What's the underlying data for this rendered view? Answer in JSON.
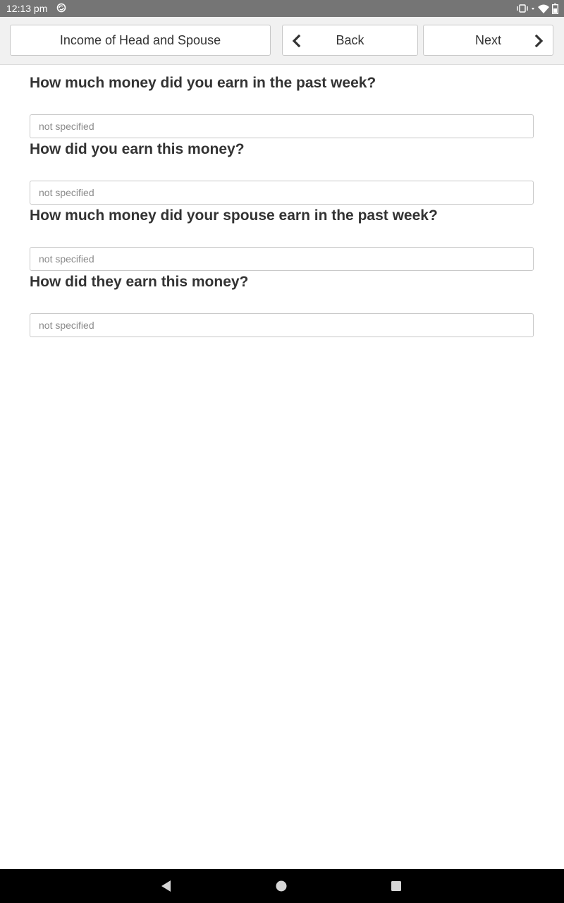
{
  "status_bar": {
    "time": "12:13 pm",
    "icons": [
      "sync-icon",
      "vibrate-icon",
      "wifi-icon",
      "battery-icon"
    ]
  },
  "toolbar": {
    "section_label": "Income of Head and Spouse",
    "back_label": "Back",
    "next_label": "Next"
  },
  "questions": [
    {
      "label": "How much money did you earn in the past week?",
      "value": "",
      "placeholder": "not specified"
    },
    {
      "label": "How did you earn this money?",
      "value": "",
      "placeholder": "not specified"
    },
    {
      "label": "How much money did your spouse earn in the past week?",
      "value": "",
      "placeholder": "not specified"
    },
    {
      "label": "How did they earn this money?",
      "value": "",
      "placeholder": "not specified"
    }
  ],
  "nav_bar": {
    "icons": [
      "back-triangle-icon",
      "home-circle-icon",
      "recents-square-icon"
    ]
  },
  "colors": {
    "status_bar_bg": "#757575",
    "toolbar_bg": "#f1f1f1",
    "text": "#333333",
    "nav_bar_bg": "#000000"
  }
}
